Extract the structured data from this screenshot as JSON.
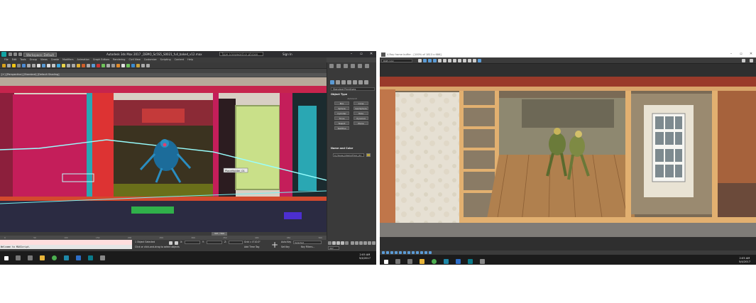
{
  "left_app": {
    "title": "Autodesk 3ds Max 2017    _DEMO_Sc5S5_S0021_full_baked_v12.max",
    "workspace": "Workspace: Default",
    "search_placeholder": "Type a keyword or phrase",
    "sign_in": "Sign In",
    "menu": [
      "File",
      "Edit",
      "Tools",
      "Group",
      "Views",
      "Create",
      "Modifiers",
      "Animation",
      "Graph Editors",
      "Rendering",
      "Civil View",
      "Customize",
      "Scripting",
      "Content",
      "Help"
    ],
    "viewport_label": "[+] [Perspective] [Standard] [Default Shading]",
    "scene_tag": "PlaceHolder_01",
    "command_panel": {
      "category": "Standard Primitives",
      "object_type_title": "Object Type",
      "autogrid": "AutoGrid",
      "object_buttons": [
        "Box",
        "Cone",
        "Sphere",
        "GeoSphere",
        "Cylinder",
        "Tube",
        "Torus",
        "Pyramid",
        "Teapot",
        "Plane",
        "TextPlus"
      ],
      "name_color_title": "Name and Color",
      "name_value": "0_House_InteriorFloor_01"
    },
    "timeline": {
      "slider": "307 / 500",
      "ticks": [
        "0",
        "50",
        "100",
        "150",
        "200",
        "250",
        "300",
        "350",
        "400",
        "450",
        "500"
      ]
    },
    "status": {
      "maxscript": "Welcome to MAXScript.",
      "selected": "1 Object Selected",
      "prompt": "Click or click-and-drag to select objects",
      "x_label": "X:",
      "y_label": "Y:",
      "z_label": "Z:",
      "grid": "Grid = 0'10.0\"",
      "add_time_tag": "Add Time Tag",
      "auto_key": "Auto Key",
      "selected_dropdown": "Selected",
      "set_key": "Set Key",
      "key_filters": "Key Filters...",
      "frame": "307"
    },
    "clock": {
      "time": "2:05 AM",
      "date": "5/4/2017"
    }
  },
  "right_app": {
    "title": "V-Ray frame buffer - [100% of 1813 x 686]",
    "channel": "RGB color",
    "clock": {
      "time": "2:05 AM",
      "date": "5/4/2017"
    }
  }
}
